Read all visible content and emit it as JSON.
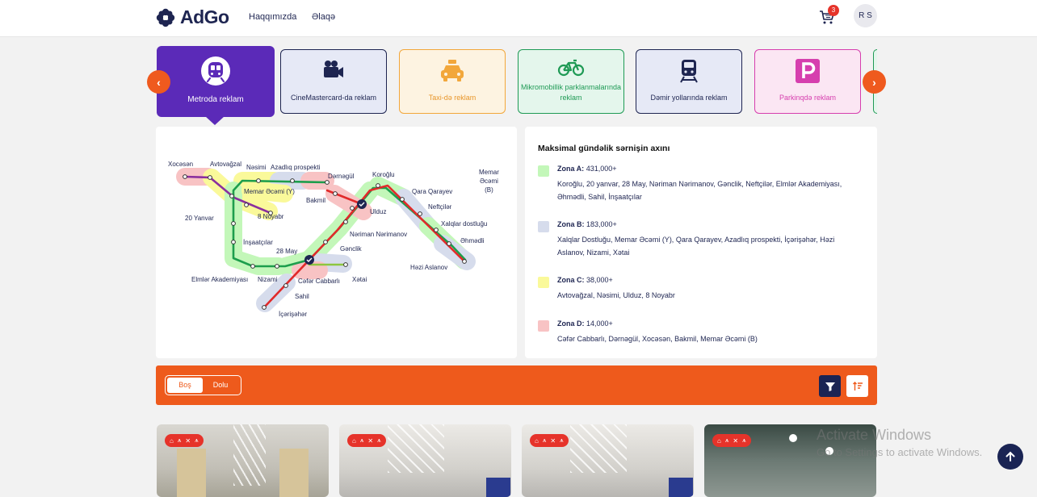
{
  "brand": {
    "name": "AdGo"
  },
  "nav": {
    "about": "Haqqımızda",
    "contact": "Əlaqə"
  },
  "cart": {
    "count": "3"
  },
  "user": {
    "initials": "R S"
  },
  "categories": [
    {
      "label": "Metroda reklam"
    },
    {
      "label": "CineMastercard-da reklam"
    },
    {
      "label": "Taxi-də reklam"
    },
    {
      "label": "Mikromobillik parklanmalarında reklam"
    },
    {
      "label": "Dəmir yollarında reklam"
    },
    {
      "label": "Parkinqdə reklam"
    }
  ],
  "map_stations": {
    "xocesen": "Xocəsən",
    "avtovagzal": "Avtovağzal",
    "nesimi": "Nəsimi",
    "azadliq": "Azadlıq prospekti",
    "dernegul": "Dərnəgül",
    "koroglu": "Koroğlu",
    "memar_b": "Memar\nƏcəmi\n(B)",
    "memar_y": "Memar Əcəmi (Y)",
    "bakmil": "Bakmil",
    "qara": "Qara Qarayev",
    "y20": "20 Yanvar",
    "noyabr": "8 Noyabr",
    "ulduz": "Ulduz",
    "neftciler": "Neftçilər",
    "xalqlar": "Xalqlar dostluğu",
    "ehmedli": "Əhmədli",
    "inshaat": "İnşaatçılar",
    "neriman": "Nəriman Nərimanov",
    "may28": "28 May",
    "genclik": "Gənclik",
    "hezi": "Həzi Aslanov",
    "elmler": "Elmlər Akademiyası",
    "nizami": "Nizami",
    "cefer": "Cəfər Cabbarlı",
    "xetai": "Xətai",
    "sahil": "Sahil",
    "icheri": "İçərişəhər"
  },
  "zones_panel": {
    "title": "Maksimal gündəlik sərnişin axını",
    "zones": [
      {
        "name": "Zona A:",
        "value": "431,000+",
        "stations": "Koroğlu, 20 yanvar, 28 May, Nəriman Nərimanov, Gənclik, Neftçilər, Elmlər Akademiyası, Əhmədli, Sahil, İnşaatçılar",
        "color": "#c3f7b9"
      },
      {
        "name": "Zona B:",
        "value": "183,000+",
        "stations": "Xalqlar Dostluğu, Memar Əcəmi (Y), Qara Qarayev, Azadlıq prospekti, İçərişəhər, Həzi Aslanov, Nizami, Xətai",
        "color": "#d6dcec"
      },
      {
        "name": "Zona C:",
        "value": "38,000+",
        "stations": "Avtovağzal, Nəsimi, Ulduz, 8 Noyabr",
        "color": "#faf99a"
      },
      {
        "name": "Zona D:",
        "value": "14,000+",
        "stations": "Cəfər Cabbarlı, Dərnəgül, Xocəsən, Bakmil, Memar Əcəmi (B)",
        "color": "#f8c3c4"
      }
    ]
  },
  "filter": {
    "empty": "Boş",
    "full": "Dolu"
  },
  "watermark": {
    "title": "Activate Windows",
    "subtitle": "Go to Settings to activate Windows."
  },
  "colors": {
    "accent": "#ee5a1c",
    "brand": "#1e2551",
    "active_category": "#5b2ab8"
  }
}
